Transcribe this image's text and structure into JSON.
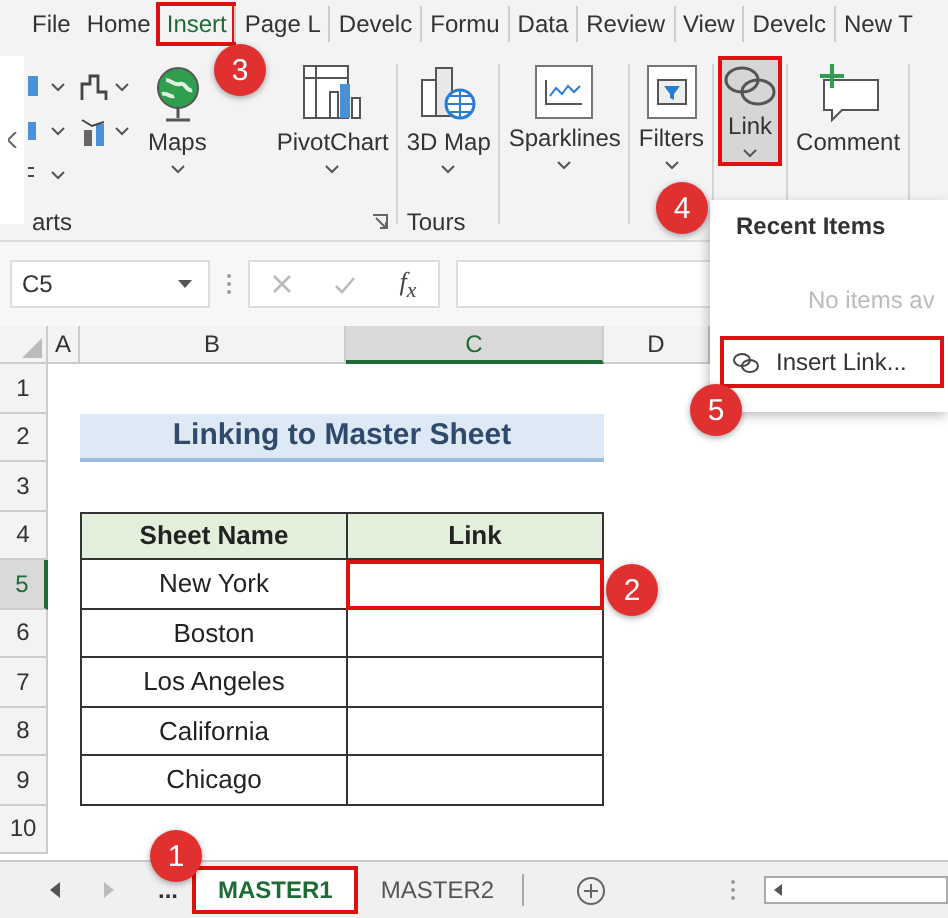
{
  "ribbon_tabs": [
    {
      "label": "File",
      "selected": false,
      "highlighted": false
    },
    {
      "label": "Home",
      "selected": false,
      "highlighted": false
    },
    {
      "label": "Insert",
      "selected": true,
      "highlighted": true
    },
    {
      "label": "Page L",
      "selected": false,
      "highlighted": false
    },
    {
      "label": "Develc",
      "selected": false,
      "highlighted": false
    },
    {
      "label": "Formu",
      "selected": false,
      "highlighted": false
    },
    {
      "label": "Data",
      "selected": false,
      "highlighted": false
    },
    {
      "label": "Review",
      "selected": false,
      "highlighted": false
    },
    {
      "label": "View",
      "selected": false,
      "highlighted": false
    },
    {
      "label": "Develc",
      "selected": false,
      "highlighted": false
    },
    {
      "label": "New T",
      "selected": false,
      "highlighted": false
    }
  ],
  "ribbon_groups": [
    {
      "label": "arts",
      "kind": "charts",
      "buttons": [
        {
          "label": "Maps",
          "kind": "maps",
          "pressed": false,
          "highlighted": false
        },
        {
          "label": "PivotChart",
          "kind": "pivotchart",
          "pressed": false,
          "highlighted": false
        }
      ]
    },
    {
      "label": "Tours",
      "kind": "plain",
      "buttons": [
        {
          "label": "3D Map",
          "kind": "map3d",
          "pressed": false,
          "highlighted": false
        }
      ]
    },
    {
      "kind": "plain",
      "buttons": [
        {
          "label": "Sparklines",
          "kind": "sparklines",
          "pressed": false,
          "highlighted": false
        }
      ]
    },
    {
      "kind": "plain",
      "buttons": [
        {
          "label": "Filters",
          "kind": "filters",
          "pressed": false,
          "highlighted": false
        }
      ]
    },
    {
      "kind": "plain",
      "buttons": [
        {
          "label": "Link",
          "kind": "link",
          "pressed": true,
          "highlighted": true
        }
      ]
    },
    {
      "kind": "plain",
      "buttons": [
        {
          "label": "Comment",
          "kind": "comment",
          "pressed": false,
          "highlighted": false
        }
      ]
    }
  ],
  "name_box": "C5",
  "function_symbol": "f$_{x}$",
  "columns": [
    {
      "label": "A",
      "selected": false
    },
    {
      "label": "B",
      "selected": false
    },
    {
      "label": "C",
      "selected": true
    },
    {
      "label": "D",
      "selected": false
    }
  ],
  "rows": [
    {
      "number": "1",
      "selected": false
    },
    {
      "number": "2",
      "selected": false,
      "kind": "title",
      "text": "Linking to Master Sheet"
    },
    {
      "number": "3",
      "selected": false
    },
    {
      "number": "4",
      "selected": false,
      "kind": "table_header",
      "cells": [
        "Sheet Name",
        "Link"
      ]
    },
    {
      "number": "5",
      "selected": true,
      "kind": "table_row",
      "cells": [
        "New York"
      ],
      "link_highlighted": true
    },
    {
      "number": "6",
      "selected": false,
      "kind": "table_row",
      "cells": [
        "Boston"
      ],
      "link_highlighted": false
    },
    {
      "number": "7",
      "selected": false,
      "kind": "table_row",
      "cells": [
        "Los Angeles"
      ],
      "link_highlighted": false
    },
    {
      "number": "8",
      "selected": false,
      "kind": "table_row",
      "cells": [
        "California"
      ],
      "link_highlighted": false
    },
    {
      "number": "9",
      "selected": false,
      "kind": "table_row",
      "cells": [
        "Chicago"
      ],
      "link_highlighted": false
    },
    {
      "number": "10",
      "selected": false
    }
  ],
  "sheet_tabs_overflow": "...",
  "sheet_tabs": [
    {
      "label": "MASTER1",
      "selected": true,
      "highlighted": true
    },
    {
      "label": "MASTER2",
      "selected": false,
      "highlighted": false
    }
  ],
  "link_menu": {
    "heading": "Recent Items",
    "empty_text": "No items av",
    "items": [
      {
        "label": "Insert Link...",
        "highlighted": true
      }
    ]
  },
  "callouts": [
    {
      "number": "1"
    },
    {
      "number": "2"
    },
    {
      "number": "3"
    },
    {
      "number": "4"
    },
    {
      "number": "5"
    }
  ]
}
